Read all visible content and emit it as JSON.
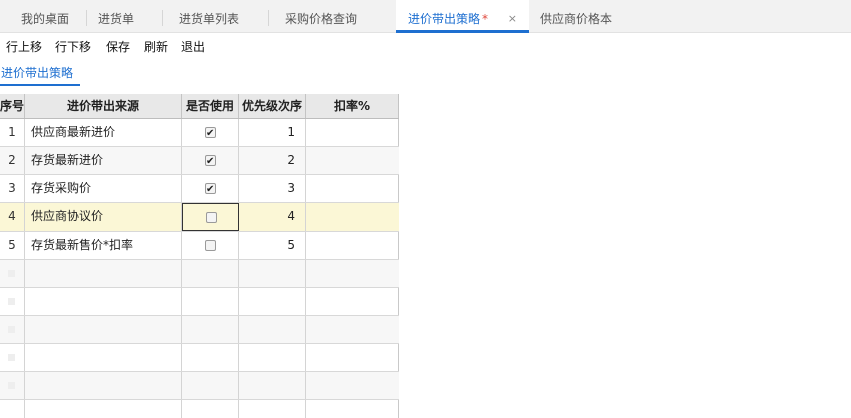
{
  "tabs": [
    {
      "label": "我的桌面"
    },
    {
      "label": "进货单"
    },
    {
      "label": "进货单列表"
    },
    {
      "label": "采购价格查询"
    },
    {
      "label": "进价带出策略",
      "dirty": "*",
      "close": "×"
    },
    {
      "label": "供应商价格本"
    }
  ],
  "toolbar": {
    "move_up": "行上移",
    "move_down": "行下移",
    "save": "保存",
    "refresh": "刷新",
    "exit": "退出"
  },
  "section": {
    "title": "进价带出策略"
  },
  "grid": {
    "columns": {
      "index": "序号",
      "source": "进价带出来源",
      "in_use": "是否使用",
      "priority": "优先级次序",
      "rate": "扣率%"
    },
    "rows": [
      {
        "index": "1",
        "source": "供应商最新进价",
        "in_use": true,
        "priority": "1",
        "rate": ""
      },
      {
        "index": "2",
        "source": "存货最新进价",
        "in_use": true,
        "priority": "2",
        "rate": ""
      },
      {
        "index": "3",
        "source": "存货采购价",
        "in_use": true,
        "priority": "3",
        "rate": ""
      },
      {
        "index": "4",
        "source": "供应商协议价",
        "in_use": false,
        "priority": "4",
        "rate": ""
      },
      {
        "index": "5",
        "source": "存货最新售价*扣率",
        "in_use": false,
        "priority": "5",
        "rate": ""
      }
    ]
  }
}
